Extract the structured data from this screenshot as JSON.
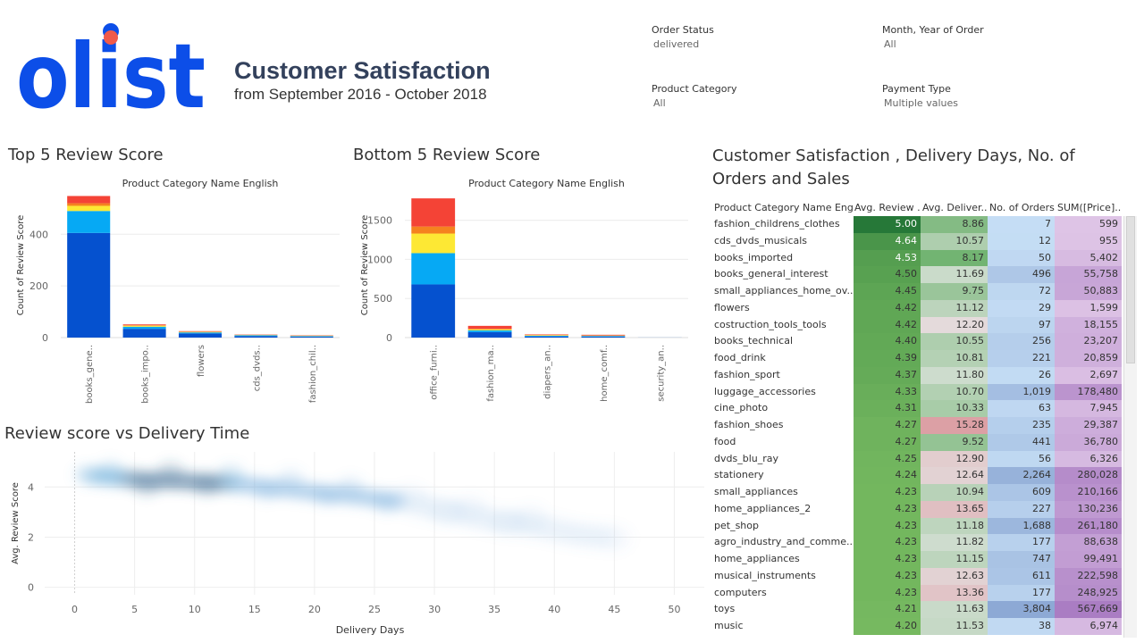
{
  "header": {
    "logo_text": "olist",
    "title": "Customer Satisfaction",
    "subtitle": "from September 2016 - October 2018"
  },
  "filters": [
    {
      "label": "Order Status",
      "value": "delivered"
    },
    {
      "label": "Month, Year of Order",
      "value": "All"
    },
    {
      "label": "Product Category",
      "value": "All"
    },
    {
      "label": "Payment Type",
      "value": "Multiple values"
    }
  ],
  "colors": {
    "score_1": "#f44336",
    "score_2": "#f5821f",
    "score_3": "#fde834",
    "score_4": "#06a9f4",
    "score_5": "#0551cf"
  },
  "top5": {
    "title": "Top 5 Review Score",
    "chart_data": {
      "type": "bar",
      "title": "Product Category Name English",
      "ylabel": "Count of Review Score",
      "categories": [
        "books_gene..",
        "books_impo..",
        "flowers",
        "cds_dvds..",
        "fashion_chil.."
      ],
      "yticks": [
        0,
        200,
        400
      ],
      "ylim": [
        0,
        560
      ],
      "stacked_series": [
        {
          "values": [
            405,
            34,
            16,
            6,
            4
          ]
        },
        {
          "values": [
            85,
            8,
            4,
            3,
            2
          ]
        },
        {
          "values": [
            20,
            4,
            2,
            1,
            1
          ]
        },
        {
          "values": [
            10,
            2,
            1,
            1,
            1
          ]
        },
        {
          "values": [
            28,
            3,
            2,
            1,
            1
          ]
        }
      ]
    }
  },
  "bottom5": {
    "title": "Bottom 5 Review Score",
    "chart_data": {
      "type": "bar",
      "title": "Product Category Name English",
      "ylabel": "Count of Review Score",
      "categories": [
        "office_furni..",
        "fashion_ma..",
        "diapers_an..",
        "home_comf..",
        "security_an.."
      ],
      "yticks": [
        0,
        500,
        1000,
        1500
      ],
      "ylim": [
        0,
        1850
      ],
      "stacked_series": [
        {
          "values": [
            680,
            70,
            15,
            14,
            1
          ]
        },
        {
          "values": [
            400,
            22,
            9,
            7,
            0
          ]
        },
        {
          "values": [
            250,
            13,
            7,
            4,
            0
          ]
        },
        {
          "values": [
            90,
            8,
            4,
            3,
            0
          ]
        },
        {
          "values": [
            360,
            37,
            6,
            8,
            0
          ]
        }
      ]
    }
  },
  "scatter": {
    "title": "Review score vs Delivery Time",
    "chart_data": {
      "type": "scatter",
      "xlabel": "Delivery Days",
      "ylabel": "Avg. Review Score",
      "xticks": [
        0,
        5,
        10,
        15,
        20,
        25,
        30,
        35,
        40,
        45,
        50
      ],
      "yticks": [
        0,
        2,
        4
      ],
      "xlim": [
        -2.5,
        52.5
      ],
      "ylim": [
        -0.3,
        5.4
      ],
      "x": [
        1,
        1.5,
        2,
        2.5,
        3,
        3.5,
        4,
        4.5,
        5,
        5.5,
        6,
        6.5,
        7,
        7.5,
        8,
        8.5,
        9,
        9.5,
        10,
        10.5,
        11,
        11.5,
        12,
        12.5,
        13,
        13.5,
        14,
        14.5,
        15,
        15.5,
        16,
        16.5,
        17,
        17.5,
        18,
        18.5,
        19,
        19.5,
        20,
        20.5,
        21,
        21.5,
        22,
        22.5,
        23,
        23.5,
        24,
        24.5,
        25,
        25.5,
        26,
        26.5,
        27,
        28,
        29,
        30,
        31,
        32,
        33,
        34,
        35,
        36,
        37,
        38,
        39,
        40,
        41,
        42,
        43,
        44,
        45,
        3,
        8,
        13,
        18,
        23,
        28,
        33,
        38,
        6,
        11,
        16,
        21,
        26,
        31,
        36
      ],
      "y": [
        4.5,
        4.45,
        4.42,
        4.4,
        4.38,
        4.36,
        4.34,
        4.33,
        4.3,
        4.3,
        4.28,
        4.27,
        4.26,
        4.25,
        4.25,
        4.24,
        4.23,
        4.22,
        4.21,
        4.2,
        4.2,
        4.18,
        4.17,
        4.15,
        4.13,
        4.12,
        4.1,
        4.08,
        4.05,
        4.03,
        4.0,
        3.98,
        3.95,
        3.92,
        3.9,
        3.87,
        3.85,
        3.82,
        3.8,
        3.77,
        3.75,
        3.72,
        3.7,
        3.68,
        3.65,
        3.62,
        3.6,
        3.58,
        3.55,
        3.52,
        3.5,
        3.48,
        3.45,
        3.35,
        3.25,
        3.15,
        3.05,
        2.95,
        2.85,
        2.75,
        2.65,
        2.6,
        2.55,
        2.45,
        2.4,
        2.3,
        2.2,
        2.1,
        2.05,
        2.0,
        1.95,
        4.7,
        4.65,
        4.55,
        4.35,
        4.05,
        3.6,
        3.2,
        2.8,
        4.0,
        4.0,
        3.8,
        3.6,
        3.3,
        3.0,
        2.6
      ]
    }
  },
  "table": {
    "title": "Customer Satisfaction , Delivery Days, No. of Orders and Sales",
    "columns": [
      "Product Category Name Eng..",
      "Avg. Review ..",
      "Avg. Deliver..",
      "No. of Orders",
      "SUM([Price].."
    ],
    "rows": [
      {
        "name": "fashion_childrens_clothes",
        "score": "5.00",
        "days": "8.86",
        "orders": "7",
        "sales": "599"
      },
      {
        "name": "cds_dvds_musicals",
        "score": "4.64",
        "days": "10.57",
        "orders": "12",
        "sales": "955"
      },
      {
        "name": "books_imported",
        "score": "4.53",
        "days": "8.17",
        "orders": "50",
        "sales": "5,402"
      },
      {
        "name": "books_general_interest",
        "score": "4.50",
        "days": "11.69",
        "orders": "496",
        "sales": "55,758"
      },
      {
        "name": "small_appliances_home_ov..",
        "score": "4.45",
        "days": "9.75",
        "orders": "72",
        "sales": "50,883"
      },
      {
        "name": "flowers",
        "score": "4.42",
        "days": "11.12",
        "orders": "29",
        "sales": "1,599"
      },
      {
        "name": "costruction_tools_tools",
        "score": "4.42",
        "days": "12.20",
        "orders": "97",
        "sales": "18,155"
      },
      {
        "name": "books_technical",
        "score": "4.40",
        "days": "10.55",
        "orders": "256",
        "sales": "23,207"
      },
      {
        "name": "food_drink",
        "score": "4.39",
        "days": "10.81",
        "orders": "221",
        "sales": "20,859"
      },
      {
        "name": "fashion_sport",
        "score": "4.37",
        "days": "11.80",
        "orders": "26",
        "sales": "2,697"
      },
      {
        "name": "luggage_accessories",
        "score": "4.33",
        "days": "10.70",
        "orders": "1,019",
        "sales": "178,480"
      },
      {
        "name": "cine_photo",
        "score": "4.31",
        "days": "10.33",
        "orders": "63",
        "sales": "7,945"
      },
      {
        "name": "fashion_shoes",
        "score": "4.27",
        "days": "15.28",
        "orders": "235",
        "sales": "29,387"
      },
      {
        "name": "food",
        "score": "4.27",
        "days": "9.52",
        "orders": "441",
        "sales": "36,780"
      },
      {
        "name": "dvds_blu_ray",
        "score": "4.25",
        "days": "12.90",
        "orders": "56",
        "sales": "6,326"
      },
      {
        "name": "stationery",
        "score": "4.24",
        "days": "12.64",
        "orders": "2,264",
        "sales": "280,028"
      },
      {
        "name": "small_appliances",
        "score": "4.23",
        "days": "10.94",
        "orders": "609",
        "sales": "210,166"
      },
      {
        "name": "home_appliances_2",
        "score": "4.23",
        "days": "13.65",
        "orders": "227",
        "sales": "130,236"
      },
      {
        "name": "pet_shop",
        "score": "4.23",
        "days": "11.18",
        "orders": "1,688",
        "sales": "261,180"
      },
      {
        "name": "agro_industry_and_comme..",
        "score": "4.23",
        "days": "11.82",
        "orders": "177",
        "sales": "88,638"
      },
      {
        "name": "home_appliances",
        "score": "4.23",
        "days": "11.15",
        "orders": "747",
        "sales": "99,491"
      },
      {
        "name": "musical_instruments",
        "score": "4.23",
        "days": "12.63",
        "orders": "611",
        "sales": "222,598"
      },
      {
        "name": "computers",
        "score": "4.23",
        "days": "13.36",
        "orders": "177",
        "sales": "248,925"
      },
      {
        "name": "toys",
        "score": "4.21",
        "days": "11.63",
        "orders": "3,804",
        "sales": "567,669"
      },
      {
        "name": "music",
        "score": "4.20",
        "days": "11.53",
        "orders": "38",
        "sales": "6,974"
      }
    ]
  }
}
